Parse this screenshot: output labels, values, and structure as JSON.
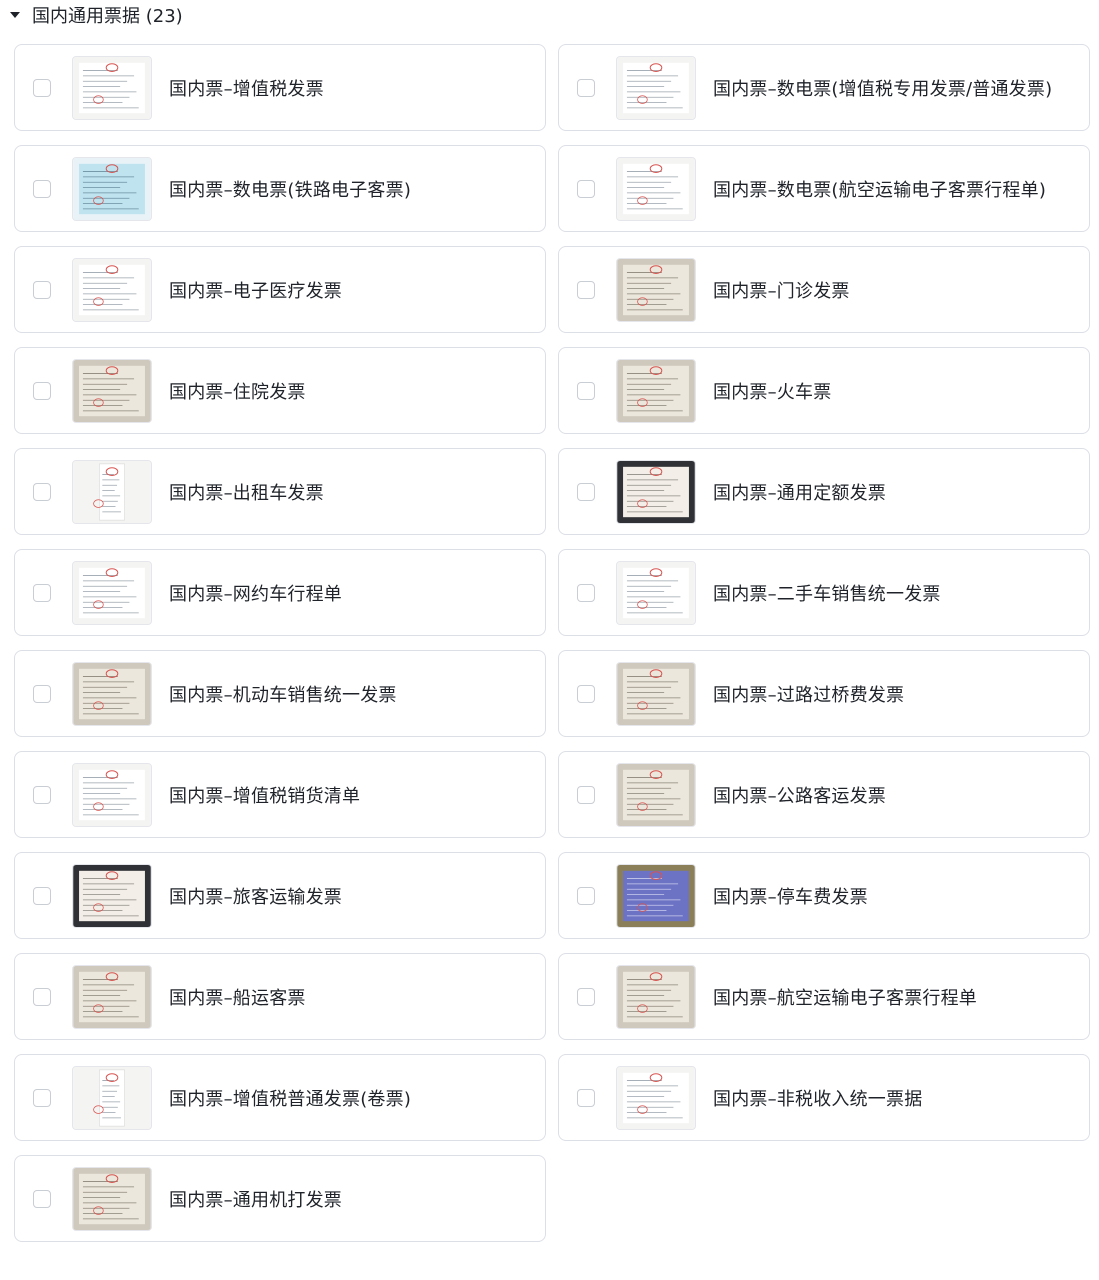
{
  "section": {
    "title": "国内通用票据 (23)",
    "icon": "caret-down-icon"
  },
  "items": [
    {
      "label": "国内票–增值税发票",
      "thumb": "light"
    },
    {
      "label": "国内票–数电票(增值税专用发票/普通发票)",
      "thumb": "light"
    },
    {
      "label": "国内票–数电票(铁路电子客票)",
      "thumb": "blue"
    },
    {
      "label": "国内票–数电票(航空运输电子客票行程单)",
      "thumb": "light"
    },
    {
      "label": "国内票–电子医疗发票",
      "thumb": "light"
    },
    {
      "label": "国内票–门诊发票",
      "thumb": "photo"
    },
    {
      "label": "国内票–住院发票",
      "thumb": "photo"
    },
    {
      "label": "国内票–火车票",
      "thumb": "photo"
    },
    {
      "label": "国内票–出租车发票",
      "thumb": "narrow"
    },
    {
      "label": "国内票–通用定额发票",
      "thumb": "dark"
    },
    {
      "label": "国内票–网约车行程单",
      "thumb": "light"
    },
    {
      "label": "国内票–二手车销售统一发票",
      "thumb": "light"
    },
    {
      "label": "国内票–机动车销售统一发票",
      "thumb": "photo"
    },
    {
      "label": "国内票–过路过桥费发票",
      "thumb": "photo"
    },
    {
      "label": "国内票–增值税销货清单",
      "thumb": "light"
    },
    {
      "label": "国内票–公路客运发票",
      "thumb": "photo"
    },
    {
      "label": "国内票–旅客运输发票",
      "thumb": "dark"
    },
    {
      "label": "国内票–停车费发票",
      "thumb": "purple"
    },
    {
      "label": "国内票–船运客票",
      "thumb": "photo"
    },
    {
      "label": "国内票–航空运输电子客票行程单",
      "thumb": "photo"
    },
    {
      "label": "国内票–增值税普通发票(卷票)",
      "thumb": "narrow"
    },
    {
      "label": "国内票–非税收入统一票据",
      "thumb": "light"
    },
    {
      "label": "国内票–通用机打发票",
      "thumb": "photo"
    }
  ],
  "colors": {
    "text": "#1f2329",
    "border": "#dcdfe6",
    "checkbox_border": "#c9cdd4",
    "stamp_red": "#d9534f"
  }
}
